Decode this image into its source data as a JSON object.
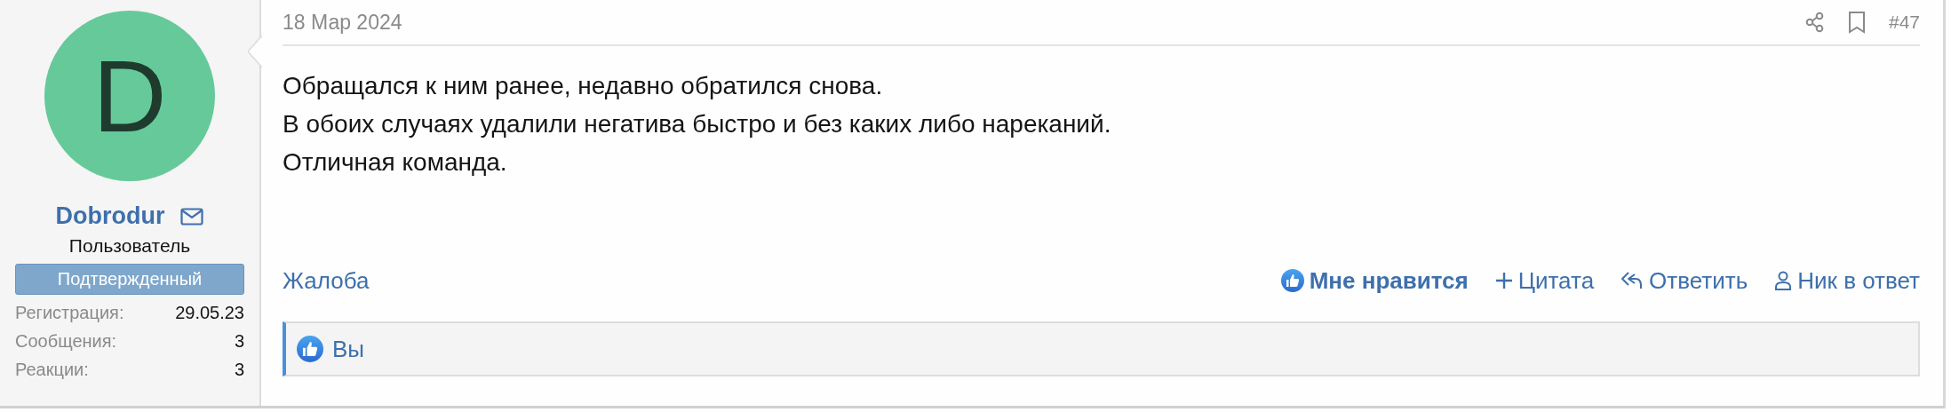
{
  "user": {
    "avatar_letter": "D",
    "name": "Dobrodur",
    "title": "Пользователь",
    "banner": "Подтвержденный",
    "stats": [
      {
        "label": "Регистрация:",
        "value": "29.05.23"
      },
      {
        "label": "Сообщения:",
        "value": "3"
      },
      {
        "label": "Реакции:",
        "value": "3"
      }
    ]
  },
  "post": {
    "date": "18 Мар 2024",
    "number": "#47",
    "lines": [
      "Обращался к ним ранее, недавно обратился снова.",
      "В обоих случаях удалили негатива быстро и без каких либо нареканий.",
      "Отличная команда."
    ],
    "report": "Жалоба",
    "actions": [
      {
        "kind": "like",
        "label": "Мне нравится",
        "selected": true
      },
      {
        "kind": "quote",
        "label": "Цитата"
      },
      {
        "kind": "reply",
        "label": "Ответить"
      },
      {
        "kind": "mention",
        "label": "Ник в ответ"
      }
    ],
    "reactions": "Вы"
  }
}
